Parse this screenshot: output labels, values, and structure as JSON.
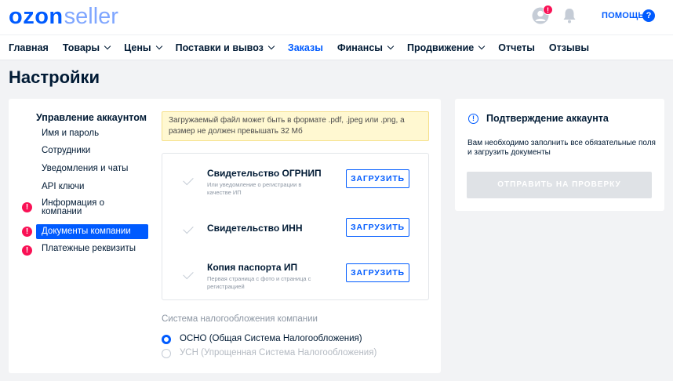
{
  "header": {
    "logo_ozon": "ozon",
    "logo_seller": "seller",
    "notification_badge": "!",
    "help_label": "ПОМОЩЬ",
    "help_icon": "?"
  },
  "nav": {
    "items": [
      {
        "label": "Главная",
        "dropdown": false
      },
      {
        "label": "Товары",
        "dropdown": true
      },
      {
        "label": "Цены",
        "dropdown": true
      },
      {
        "label": "Поставки и вывоз",
        "dropdown": true
      },
      {
        "label": "Заказы",
        "dropdown": false,
        "active": true
      },
      {
        "label": "Финансы",
        "dropdown": true
      },
      {
        "label": "Продвижение",
        "dropdown": true
      },
      {
        "label": "Отчеты",
        "dropdown": false
      },
      {
        "label": "Отзывы",
        "dropdown": false
      }
    ]
  },
  "page": {
    "title": "Настройки"
  },
  "menu": {
    "heading": "Управление аккаунтом",
    "items": [
      {
        "label": "Имя и пароль",
        "warning": false
      },
      {
        "label": "Сотрудники",
        "warning": false
      },
      {
        "label": "Уведомления и чаты",
        "warning": false
      },
      {
        "label": "API ключи",
        "warning": false
      },
      {
        "label": "Информация о компании",
        "warning": true
      },
      {
        "label": "Документы компании",
        "warning": true,
        "selected": true
      },
      {
        "label": "Платежные реквизиты",
        "warning": true
      }
    ],
    "warning_glyph": "!"
  },
  "banner": {
    "text": "Загружаемый файл может быть в формате .pdf, .jpeg или .png, а размер не должен превышать 32 Мб"
  },
  "documents": [
    {
      "title": "Свидетельство ОГРНИП",
      "subtitle": "Или уведомление о регистрации в качестве ИП",
      "button": "ЗАГРУЗИТЬ"
    },
    {
      "title": "Свидетельство ИНН",
      "subtitle": "",
      "button": "ЗАГРУЗИТЬ"
    },
    {
      "title": "Копия паспорта ИП",
      "subtitle": "Первая страница с фото и страница с регистрацией",
      "button": "ЗАГРУЗИТЬ"
    }
  ],
  "tax": {
    "label": "Система налогообложения компании",
    "options": [
      {
        "label": "ОСНО (Общая Система Налогообложения)",
        "selected": true
      },
      {
        "label": "УСН (Упрощенная Система Налогообложения)",
        "selected": false
      }
    ]
  },
  "confirm": {
    "icon": "!",
    "title": "Подтверждение аккаунта",
    "text": "Вам необходимо заполнить все обязательные поля и загрузить документы",
    "button": "ОТПРАВИТЬ НА ПРОВЕРКУ"
  },
  "colors": {
    "brand": "#005bff",
    "warning": "#f91155",
    "banner_bg": "#fff8d1",
    "disabled": "#dfe2e6"
  }
}
